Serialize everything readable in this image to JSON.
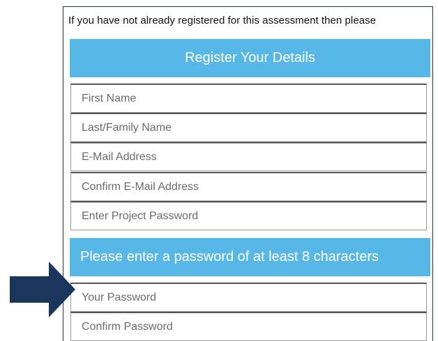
{
  "intro_text": "If you have not already registered for this assessment then please",
  "register_banner": "Register Your Details",
  "fields": {
    "first_name": {
      "placeholder": "First Name",
      "value": ""
    },
    "last_name": {
      "placeholder": "Last/Family Name",
      "value": ""
    },
    "email": {
      "placeholder": "E-Mail Address",
      "value": ""
    },
    "confirm_email": {
      "placeholder": "Confirm E-Mail Address",
      "value": ""
    },
    "project_password": {
      "placeholder": "Enter Project Password",
      "value": ""
    },
    "your_password": {
      "placeholder": "Your Password",
      "value": ""
    },
    "confirm_password": {
      "placeholder": "Confirm Password",
      "value": ""
    }
  },
  "password_banner": "Please enter a password of at least 8 characters",
  "indicator": {
    "icon": "arrow-right-icon",
    "color": "#1b365d"
  },
  "colors": {
    "banner_bg": "#57b7e7",
    "banner_text": "#ffffff",
    "panel_border": "#1b2f4f"
  }
}
